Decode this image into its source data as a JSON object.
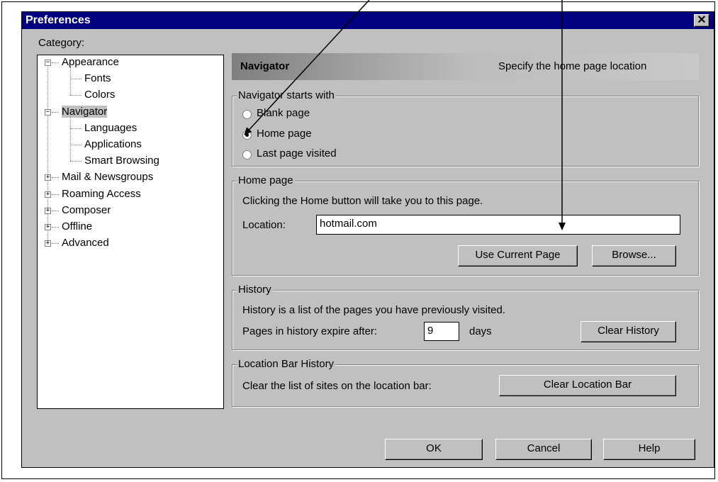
{
  "window": {
    "title": "Preferences",
    "close_glyph": "✕"
  },
  "category_label": "Category:",
  "tree": [
    {
      "label": "Appearance",
      "expander": "−"
    },
    {
      "label": "Fonts"
    },
    {
      "label": "Colors"
    },
    {
      "label": "Navigator",
      "expander": "−",
      "selected": true
    },
    {
      "label": "Languages"
    },
    {
      "label": "Applications"
    },
    {
      "label": "Smart Browsing"
    },
    {
      "label": "Mail & Newsgroups",
      "expander": "+"
    },
    {
      "label": "Roaming Access",
      "expander": "+"
    },
    {
      "label": "Composer",
      "expander": "+"
    },
    {
      "label": "Offline",
      "expander": "+"
    },
    {
      "label": "Advanced",
      "expander": "+"
    }
  ],
  "panel": {
    "title": "Navigator",
    "description": "Specify the home page location"
  },
  "starts_with": {
    "legend": "Navigator starts with",
    "options": [
      {
        "label": "Blank page",
        "checked": false
      },
      {
        "label": "Home page",
        "checked": true
      },
      {
        "label": "Last page visited",
        "checked": false
      }
    ]
  },
  "home_page": {
    "legend": "Home page",
    "info": "Clicking the Home button will take you to this page.",
    "location_label": "Location:",
    "location_value": "hotmail.com",
    "use_current_label": "Use Current Page",
    "browse_label": "Browse..."
  },
  "history": {
    "legend": "History",
    "info": "History is a list of the pages you have previously visited.",
    "expire_label": "Pages in history expire after:",
    "expire_value": "9",
    "days_label": "days",
    "clear_label": "Clear History"
  },
  "location_bar": {
    "legend": "Location Bar History",
    "info": "Clear the list of sites on the location bar:",
    "clear_label": "Clear Location Bar"
  },
  "footer": {
    "ok_label": "OK",
    "cancel_label": "Cancel",
    "help_label": "Help"
  }
}
